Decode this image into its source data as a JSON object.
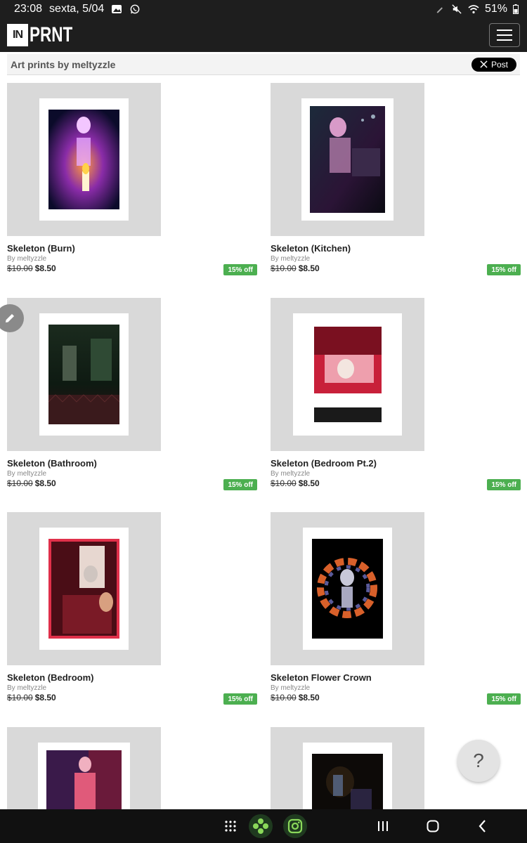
{
  "status_bar": {
    "time": "23:08",
    "date": "sexta, 5/04",
    "battery": "51%"
  },
  "header": {
    "logo_box": "IN",
    "logo_text": "PRNT"
  },
  "subheader": {
    "title": "Art prints by meltyzzle",
    "share_label": "Post"
  },
  "products": [
    {
      "name": "Skeleton (Burn)",
      "by": "By meltyzzle",
      "old_price": "$10.00",
      "price": "$8.50",
      "discount": "15% off"
    },
    {
      "name": "Skeleton (Kitchen)",
      "by": "By meltyzzle",
      "old_price": "$10.00",
      "price": "$8.50",
      "discount": "15% off"
    },
    {
      "name": "Skeleton (Bathroom)",
      "by": "By meltyzzle",
      "old_price": "$10.00",
      "price": "$8.50",
      "discount": "15% off"
    },
    {
      "name": "Skeleton (Bedroom Pt.2)",
      "by": "By meltyzzle",
      "old_price": "$10.00",
      "price": "$8.50",
      "discount": "15% off"
    },
    {
      "name": "Skeleton (Bedroom)",
      "by": "By meltyzzle",
      "old_price": "$10.00",
      "price": "$8.50",
      "discount": "15% off"
    },
    {
      "name": "Skeleton Flower Crown",
      "by": "By meltyzzle",
      "old_price": "$10.00",
      "price": "$8.50",
      "discount": "15% off"
    }
  ],
  "help_label": "?",
  "colors": {
    "header_bg": "#1e1e1e",
    "badge": "#4caf50",
    "thumb_bg": "#d9d9d9"
  }
}
